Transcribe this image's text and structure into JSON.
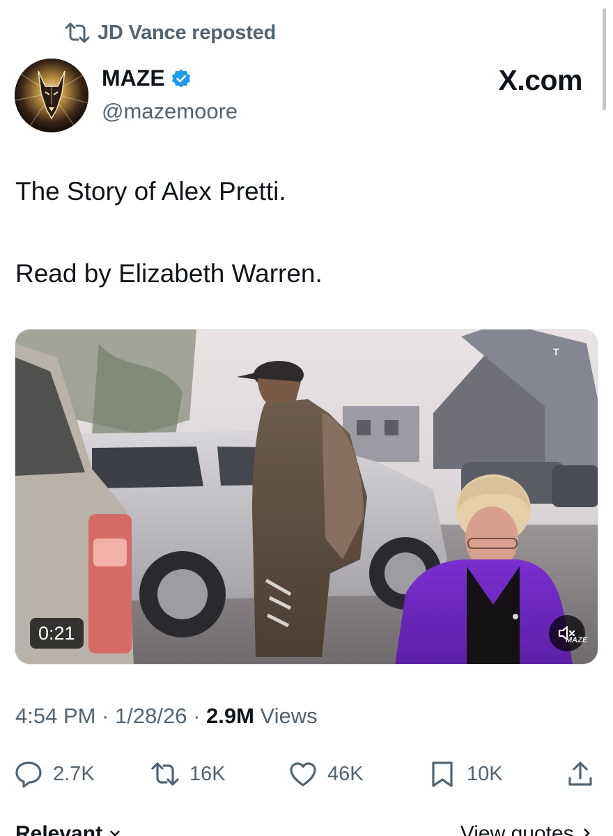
{
  "repost": {
    "text": "JD Vance reposted"
  },
  "author": {
    "name": "MAZE",
    "handle": "@mazemoore",
    "verified": true
  },
  "site_label": "X.com",
  "post": {
    "line1": "The Story of Alex Pretti.",
    "line2": "Read by Elizabeth Warren."
  },
  "video": {
    "duration": "0:21",
    "watermark": "MAZE",
    "corner_mark": "T"
  },
  "meta": {
    "time": "4:54 PM",
    "sep1": " · ",
    "date": "1/28/26",
    "sep2": " · ",
    "views_count": "2.9M",
    "views_label": " Views"
  },
  "actions": {
    "replies": "2.7K",
    "reposts": "16K",
    "likes": "46K",
    "bookmarks": "10K"
  },
  "bottom": {
    "relevant": "Relevant",
    "view_quotes": "View quotes"
  },
  "colors": {
    "text": "#0f1419",
    "secondary": "#536471",
    "verified_blue": "#1d9bf0"
  },
  "icons": [
    "repost-icon",
    "verified-badge-icon",
    "reply-icon",
    "like-icon",
    "bookmark-icon",
    "share-icon",
    "mute-icon",
    "chevron-down-icon",
    "chevron-right-icon"
  ]
}
